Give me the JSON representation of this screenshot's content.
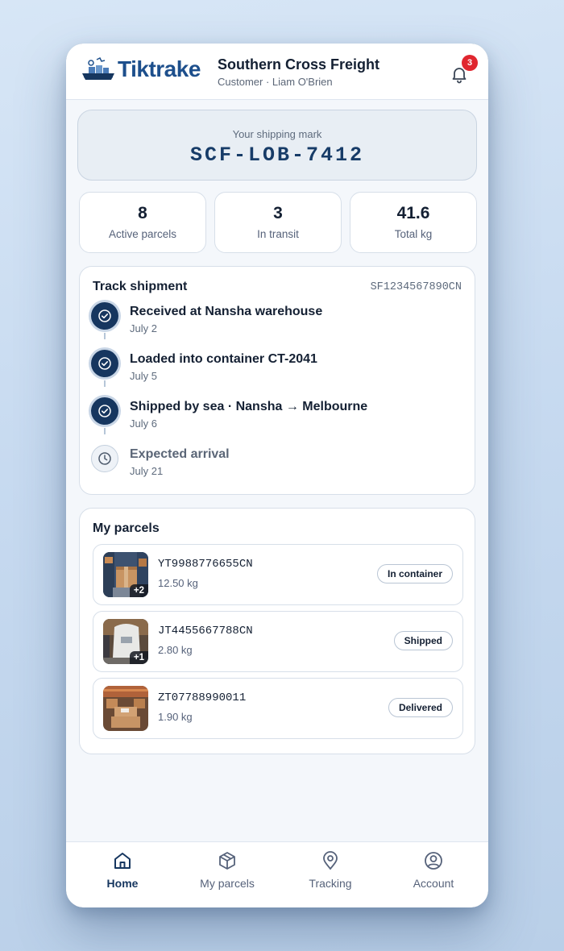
{
  "header": {
    "brand": "Tiktrake",
    "company_name": "Southern Cross Freight",
    "subtitle": "Customer · Liam O'Brien",
    "notification_count": "3"
  },
  "shipping_mark": {
    "label": "Your shipping mark",
    "value": "SCF-LOB-7412"
  },
  "stats": [
    {
      "value": "8",
      "label": "Active parcels"
    },
    {
      "value": "3",
      "label": "In transit"
    },
    {
      "value": "41.6",
      "label": "Total kg"
    }
  ],
  "track": {
    "title": "Track shipment",
    "tracking_number": "SF1234567890CN",
    "steps": [
      {
        "title": "Received at Nansha warehouse",
        "date": "July 2",
        "status": "done",
        "icon": "check-icon"
      },
      {
        "title": "Loaded into container CT-2041",
        "date": "July 5",
        "status": "done",
        "icon": "check-icon"
      },
      {
        "title": "Shipped by sea · Nansha → Melbourne",
        "date": "July 6",
        "status": "done",
        "icon": "check-icon"
      },
      {
        "title": "Expected arrival",
        "date": "July 21",
        "status": "pending",
        "icon": "clock-icon"
      }
    ]
  },
  "parcels": {
    "title": "My parcels",
    "items": [
      {
        "code": "YT9988776655CN",
        "weight": "12.50 kg",
        "status": "In container",
        "extra": "+2"
      },
      {
        "code": "JT4455667788CN",
        "weight": "2.80 kg",
        "status": "Shipped",
        "extra": "+1"
      },
      {
        "code": "ZT07788990011",
        "weight": "1.90 kg",
        "status": "Delivered",
        "extra": ""
      }
    ]
  },
  "nav": [
    {
      "label": "Home",
      "icon": "home-icon",
      "active": true
    },
    {
      "label": "My parcels",
      "icon": "box-icon",
      "active": false
    },
    {
      "label": "Tracking",
      "icon": "map-pin-icon",
      "active": false
    },
    {
      "label": "Account",
      "icon": "user-circle-icon",
      "active": false
    }
  ],
  "colors": {
    "primary": "#16365f",
    "brand": "#1d4f8c",
    "badge": "#e0262f",
    "background": "#f4f7fb"
  }
}
